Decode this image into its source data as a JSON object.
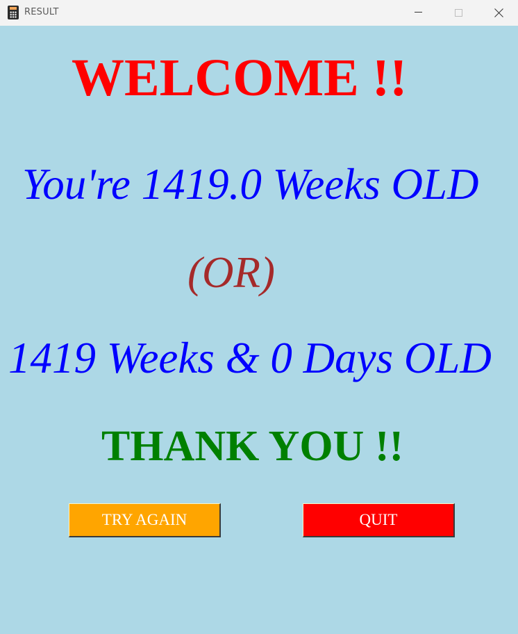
{
  "window": {
    "title": "RESULT",
    "app_icon": "calculator-icon",
    "controls": [
      "minimize-icon",
      "maximize-icon",
      "close-icon"
    ]
  },
  "content": {
    "welcome": "WELCOME !!",
    "weeks_decimal": "You're 1419.0 Weeks OLD",
    "or": "(OR)",
    "weeks_days": "1419 Weeks & 0 Days OLD",
    "thank_you": "THANK YOU !!"
  },
  "buttons": {
    "try_again": "TRY AGAIN",
    "quit": "QUIT"
  },
  "colors": {
    "background": "#add8e6",
    "welcome": "#ff0000",
    "weeks": "#0000ff",
    "or": "#a52a2a",
    "thank_you": "#008000",
    "try_again_bg": "#ffa500",
    "quit_bg": "#ff0000",
    "button_text": "#ffffff"
  }
}
